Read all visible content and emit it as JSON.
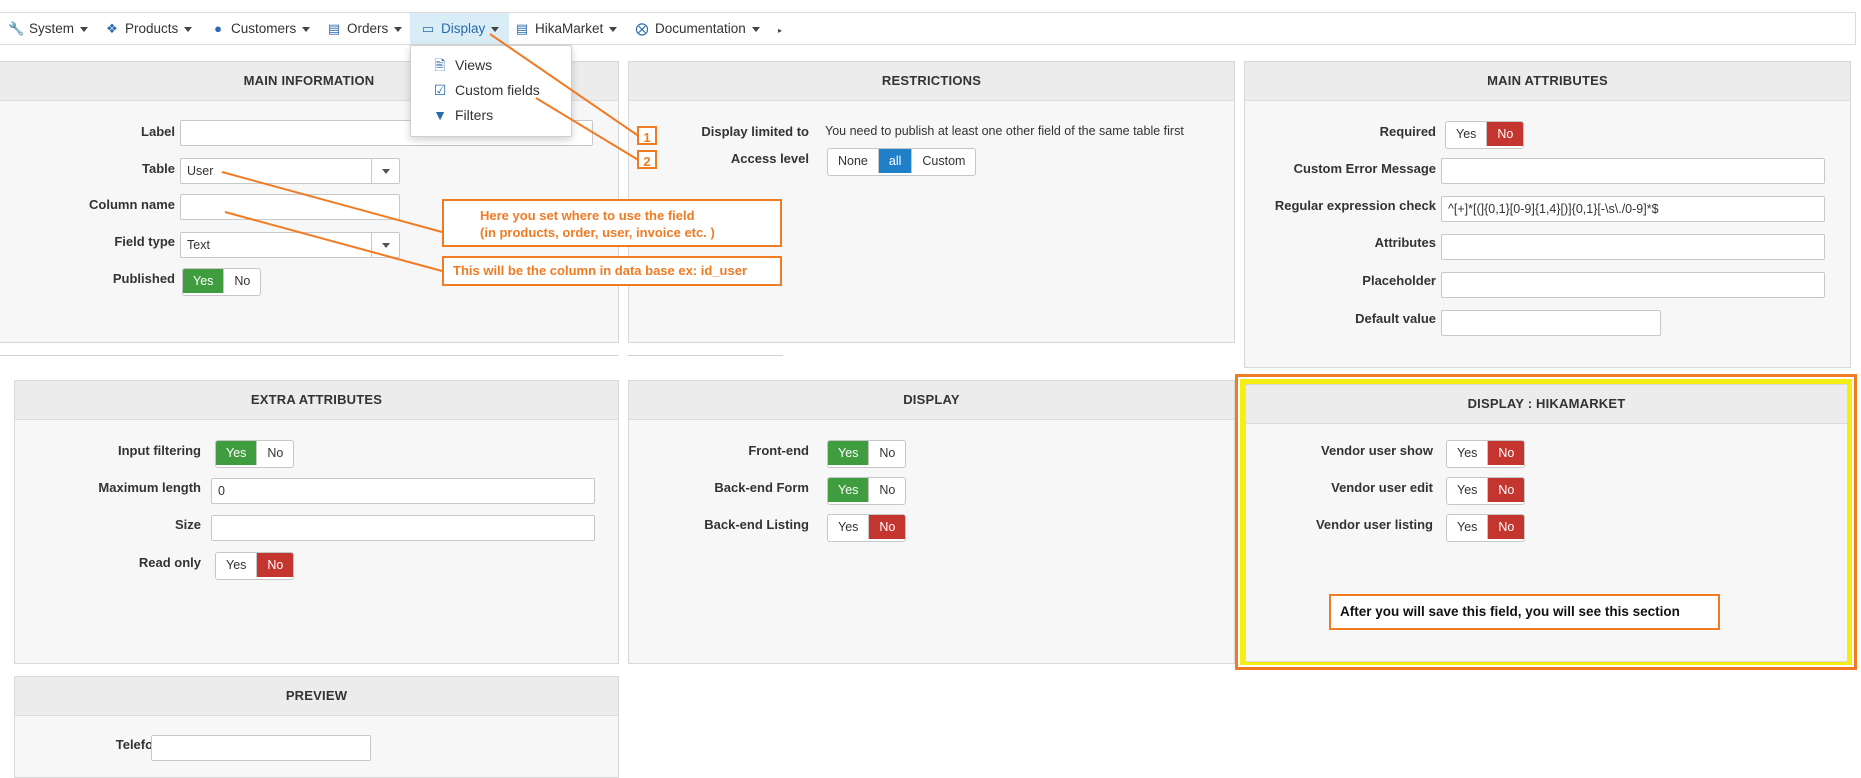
{
  "menu": {
    "items": [
      {
        "label": "System",
        "icon": "wrench-icon"
      },
      {
        "label": "Products",
        "icon": "cubes-icon"
      },
      {
        "label": "Customers",
        "icon": "user-icon"
      },
      {
        "label": "Orders",
        "icon": "credit-card-icon"
      },
      {
        "label": "Display",
        "icon": "monitor-icon"
      },
      {
        "label": "HikaMarket",
        "icon": "store-icon"
      },
      {
        "label": "Documentation",
        "icon": "lifebuoy-icon"
      }
    ],
    "display_dropdown": [
      "Views",
      "Custom fields",
      "Filters"
    ]
  },
  "main_information": {
    "title": "MAIN INFORMATION",
    "label_label": "Label",
    "label_value": "",
    "table_label": "Table",
    "table_value": "User",
    "column_label": "Column name",
    "column_value": "",
    "fieldtype_label": "Field type",
    "fieldtype_value": "Text",
    "published_label": "Published",
    "yes": "Yes",
    "no": "No"
  },
  "restrictions": {
    "title": "RESTRICTIONS",
    "display_limited_label": "Display limited to",
    "display_limited_text": "You need to publish at least one other field of the same table first",
    "access_label": "Access level",
    "access_options": [
      "None",
      "all",
      "Custom"
    ]
  },
  "main_attributes": {
    "title": "MAIN ATTRIBUTES",
    "required_label": "Required",
    "error_label": "Custom Error Message",
    "regex_label": "Regular expression check",
    "regex_value": "^[+]*[(]{0,1}[0-9]{1,4}[)]{0,1}[-\\s\\./0-9]*$",
    "attributes_label": "Attributes",
    "placeholder_label": "Placeholder",
    "default_label": "Default value",
    "yes": "Yes",
    "no": "No"
  },
  "extra_attributes": {
    "title": "EXTRA ATTRIBUTES",
    "filtering_label": "Input filtering",
    "maxlen_label": "Maximum length",
    "maxlen_value": "0",
    "size_label": "Size",
    "readonly_label": "Read only",
    "yes": "Yes",
    "no": "No"
  },
  "display": {
    "title": "DISPLAY",
    "frontend_label": "Front-end",
    "backend_form_label": "Back-end Form",
    "backend_listing_label": "Back-end Listing",
    "yes": "Yes",
    "no": "No"
  },
  "display_hikamarket": {
    "title": "DISPLAY : HIKAMARKET",
    "show_label": "Vendor user show",
    "edit_label": "Vendor user edit",
    "listing_label": "Vendor user listing",
    "yes": "Yes",
    "no": "No"
  },
  "preview": {
    "title": "PREVIEW",
    "telefon_label": "Telefon"
  },
  "annotations": {
    "num1": "1",
    "num2": "2",
    "table_note_line1": "Here you set where to use the field",
    "table_note_line2": "(in products, order, user, invoice etc. )",
    "column_note": "This will be the column in data base ex: id_user",
    "section_note": "After you will save this field, you will see this section"
  },
  "colors": {
    "annotation": "#f07b23",
    "highlight": "#f5ee14",
    "yes_active": "#3f9c3f",
    "no_active": "#c43530",
    "all_active": "#1f7fc8"
  }
}
